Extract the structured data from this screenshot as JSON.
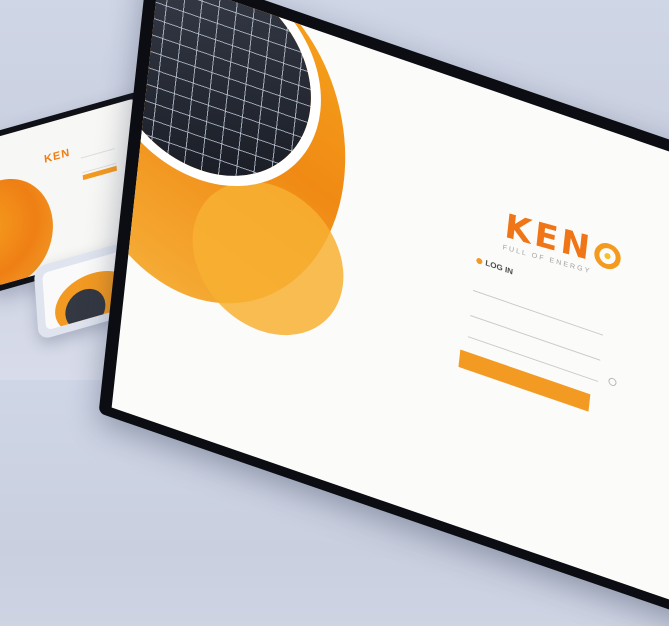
{
  "brand": {
    "name": "KEN",
    "tagline": "FULL OF ENERGY"
  },
  "login": {
    "title": "LOG IN"
  },
  "colors": {
    "accent": "#f39a22",
    "brand_orange": "#ef7516",
    "monitor_bezel": "#0c0d12"
  },
  "icons": {
    "logo_o": "sun-circle-icon",
    "help": "help-icon"
  }
}
